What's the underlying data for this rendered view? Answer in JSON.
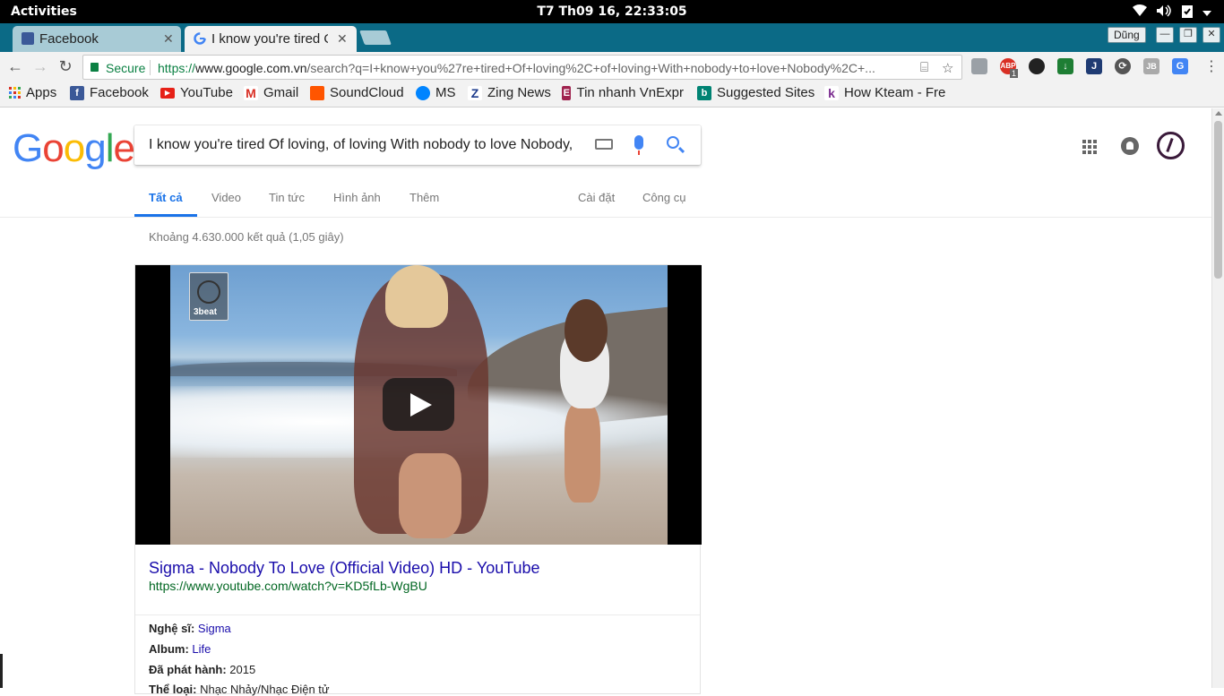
{
  "system": {
    "activities": "Activities",
    "clock": "T7 Th09 16, 22:33:05",
    "tray_icons": [
      "wifi-icon",
      "volume-icon",
      "clipboard-icon",
      "power-menu-icon"
    ]
  },
  "tabs": [
    {
      "title": "Facebook",
      "favicon": "facebook-icon",
      "active": false
    },
    {
      "title": "I know you're tired Of",
      "favicon": "google-icon",
      "active": true
    }
  ],
  "window": {
    "user": "Dũng",
    "controls": [
      "minimize",
      "maximize",
      "close"
    ]
  },
  "toolbar": {
    "secure_label": "Secure",
    "url_scheme": "https://",
    "url_host": "www.google.com.vn",
    "url_path": "/search?q=I+know+you%27re+tired+Of+loving%2C+of+loving+With+nobody+to+love+Nobody%2C+...",
    "extensions": [
      "extension-cube-icon",
      "adblock-icon",
      "gnome-icon",
      "download-icon",
      "jira-icon",
      "sync-icon",
      "jetbrains-icon",
      "translate-icon"
    ],
    "adblock_count": "1"
  },
  "bookmarks": [
    {
      "label": "Apps",
      "icon": "apps-grid-icon"
    },
    {
      "label": "Facebook",
      "icon": "facebook-icon"
    },
    {
      "label": "YouTube",
      "icon": "youtube-icon"
    },
    {
      "label": "Gmail",
      "icon": "gmail-icon"
    },
    {
      "label": "SoundCloud",
      "icon": "soundcloud-icon"
    },
    {
      "label": "MS",
      "icon": "messenger-icon"
    },
    {
      "label": "Zing News",
      "icon": "zing-icon"
    },
    {
      "label": "Tin nhanh VnExpr",
      "icon": "vnexpress-icon"
    },
    {
      "label": "Suggested Sites",
      "icon": "bing-icon"
    },
    {
      "label": "How Kteam - Fre",
      "icon": "kteam-icon"
    }
  ],
  "google": {
    "logo": "Google",
    "query": "I know you're tired Of loving, of loving With nobody to love Nobody,",
    "tabs": [
      "Tất cả",
      "Video",
      "Tin tức",
      "Hình ảnh",
      "Thêm"
    ],
    "right_tabs": [
      "Cài đặt",
      "Công cụ"
    ],
    "stats": "Khoảng 4.630.000 kết quả (1,05 giây)"
  },
  "result": {
    "video_badge": "3beat",
    "title": "Sigma - Nobody To Love (Official Video) HD - YouTube",
    "url": "https://www.youtube.com/watch?v=KD5fLb-WgBU",
    "details": [
      {
        "label": "Nghệ sĩ:",
        "value": "Sigma",
        "link": true
      },
      {
        "label": "Album:",
        "value": "Life",
        "link": true
      },
      {
        "label": "Đã phát hành:",
        "value": "2015",
        "link": false
      },
      {
        "label": "Thể loại:",
        "value": "Nhạc Nhảy/Nhạc Điện tử",
        "link": false
      }
    ]
  },
  "colors": {
    "tab_strip": "#0b6a86",
    "link": "#1a0dab",
    "url_green": "#006621",
    "google_blue": "#4285f4",
    "google_red": "#ea4335",
    "google_yellow": "#fbbc05",
    "google_green": "#34a853"
  }
}
